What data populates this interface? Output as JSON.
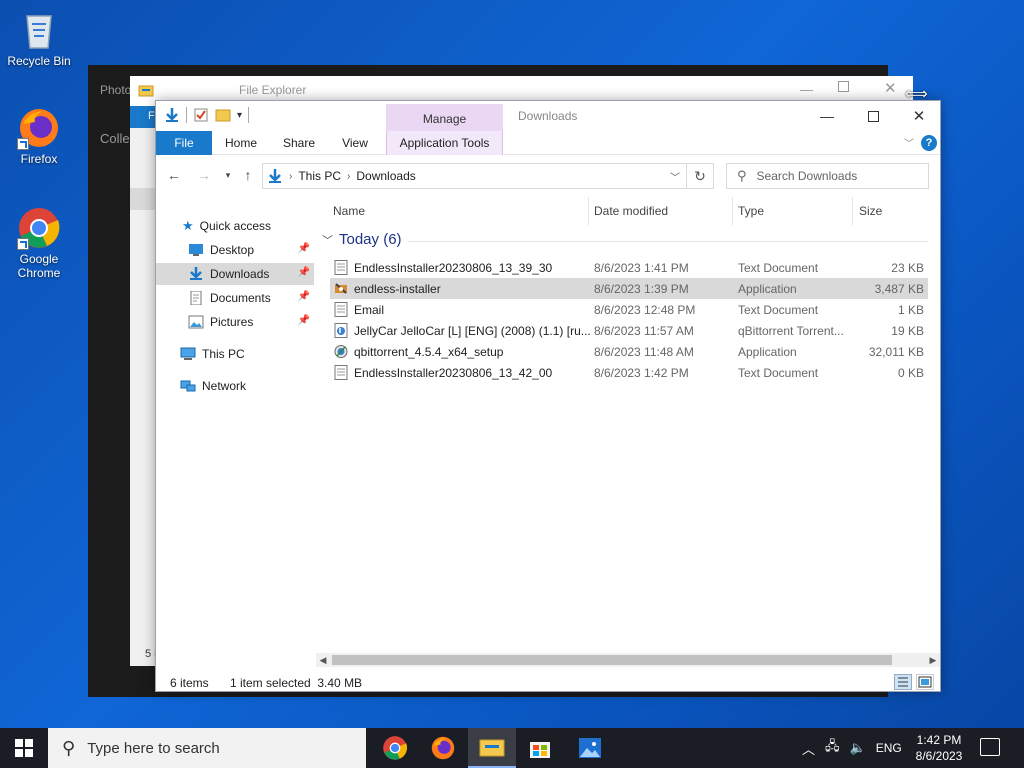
{
  "desktop": {
    "icons": [
      {
        "label": "Recycle Bin"
      },
      {
        "label": "Firefox"
      },
      {
        "label": "Google Chrome"
      }
    ]
  },
  "background_windows": {
    "photos_title": "Photo",
    "collection_label": "Colle",
    "explorer_title": "File Explorer",
    "file_tab": "F",
    "items_count": "5 i"
  },
  "explorer": {
    "title": "Downloads",
    "contextual_tab": "Manage",
    "tabs": [
      "File",
      "Home",
      "Share",
      "View",
      "Application Tools"
    ],
    "address": {
      "crumbs": [
        "This PC",
        "Downloads"
      ]
    },
    "search_placeholder": "Search Downloads",
    "nav": [
      {
        "label": "Quick access",
        "icon": "star-icon"
      },
      {
        "label": "Desktop",
        "icon": "desktop-folder-icon",
        "pinned": true
      },
      {
        "label": "Downloads",
        "icon": "download-folder-icon",
        "pinned": true,
        "selected": true
      },
      {
        "label": "Documents",
        "icon": "documents-folder-icon",
        "pinned": true
      },
      {
        "label": "Pictures",
        "icon": "pictures-folder-icon",
        "pinned": true
      },
      {
        "label": "This PC",
        "icon": "computer-icon"
      },
      {
        "label": "Network",
        "icon": "network-icon"
      }
    ],
    "columns": [
      "Name",
      "Date modified",
      "Type",
      "Size"
    ],
    "group": "Today (6)",
    "files": [
      {
        "name": "EndlessInstaller20230806_13_39_30",
        "date": "8/6/2023 1:41 PM",
        "type": "Text Document",
        "size": "23 KB",
        "icon": "text-file-icon"
      },
      {
        "name": "endless-installer",
        "date": "8/6/2023 1:39 PM",
        "type": "Application",
        "size": "3,487 KB",
        "icon": "installer-app-icon",
        "selected": true
      },
      {
        "name": "Email",
        "date": "8/6/2023 12:48 PM",
        "type": "Text Document",
        "size": "1 KB",
        "icon": "text-file-icon"
      },
      {
        "name": "JellyCar JelloCar [L] [ENG] (2008) (1.1) [ru...",
        "date": "8/6/2023 11:57 AM",
        "type": "qBittorrent Torrent...",
        "size": "19 KB",
        "icon": "torrent-file-icon"
      },
      {
        "name": "qbittorrent_4.5.4_x64_setup",
        "date": "8/6/2023 11:48 AM",
        "type": "Application",
        "size": "32,011 KB",
        "icon": "qbittorrent-setup-icon"
      },
      {
        "name": "EndlessInstaller20230806_13_42_00",
        "date": "8/6/2023 1:42 PM",
        "type": "Text Document",
        "size": "0 KB",
        "icon": "text-file-icon"
      }
    ],
    "status": {
      "items": "6 items",
      "selection": "1 item selected  3.40 MB"
    }
  },
  "taskbar": {
    "search_placeholder": "Type here to search",
    "language": "ENG",
    "time": "1:42 PM",
    "date": "8/6/2023"
  },
  "colors": {
    "accent": "#1979ca",
    "manage_tab": "#ead7f4",
    "taskbar": "#1b1d24"
  }
}
